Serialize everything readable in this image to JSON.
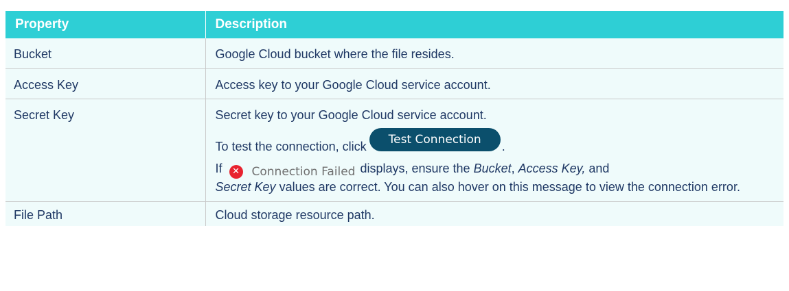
{
  "table": {
    "headers": [
      "Property",
      "Description"
    ],
    "rows": [
      {
        "property": "Bucket",
        "description": "Google Cloud bucket where the file resides."
      },
      {
        "property": "Access Key",
        "description": "Access key to your Google Cloud service account."
      },
      {
        "property": "Secret Key",
        "description": "Secret key to your Google Cloud service account.",
        "test_prefix": "To test the connection, click",
        "test_button_label": "Test Connection",
        "test_suffix": ".",
        "if_text": "If",
        "fail_icon": "error-circle-x-icon",
        "fail_label": "Connection Failed",
        "fail_part1": "displays, ensure the",
        "fail_bucket": "Bucket",
        "fail_comma": ",",
        "fail_access": "Access Key,",
        "fail_and": "and",
        "fail_secret": "Secret Key",
        "fail_part2": "values are correct. You can also hover on this message to view the connection error."
      },
      {
        "property": "File Path",
        "description": "Cloud storage resource path."
      }
    ]
  },
  "colors": {
    "header_bg": "#2ecfd5",
    "row_bg": "#effbfb",
    "text": "#1f3864",
    "button_bg": "#0b4f6c",
    "error_red": "#e8232f"
  }
}
